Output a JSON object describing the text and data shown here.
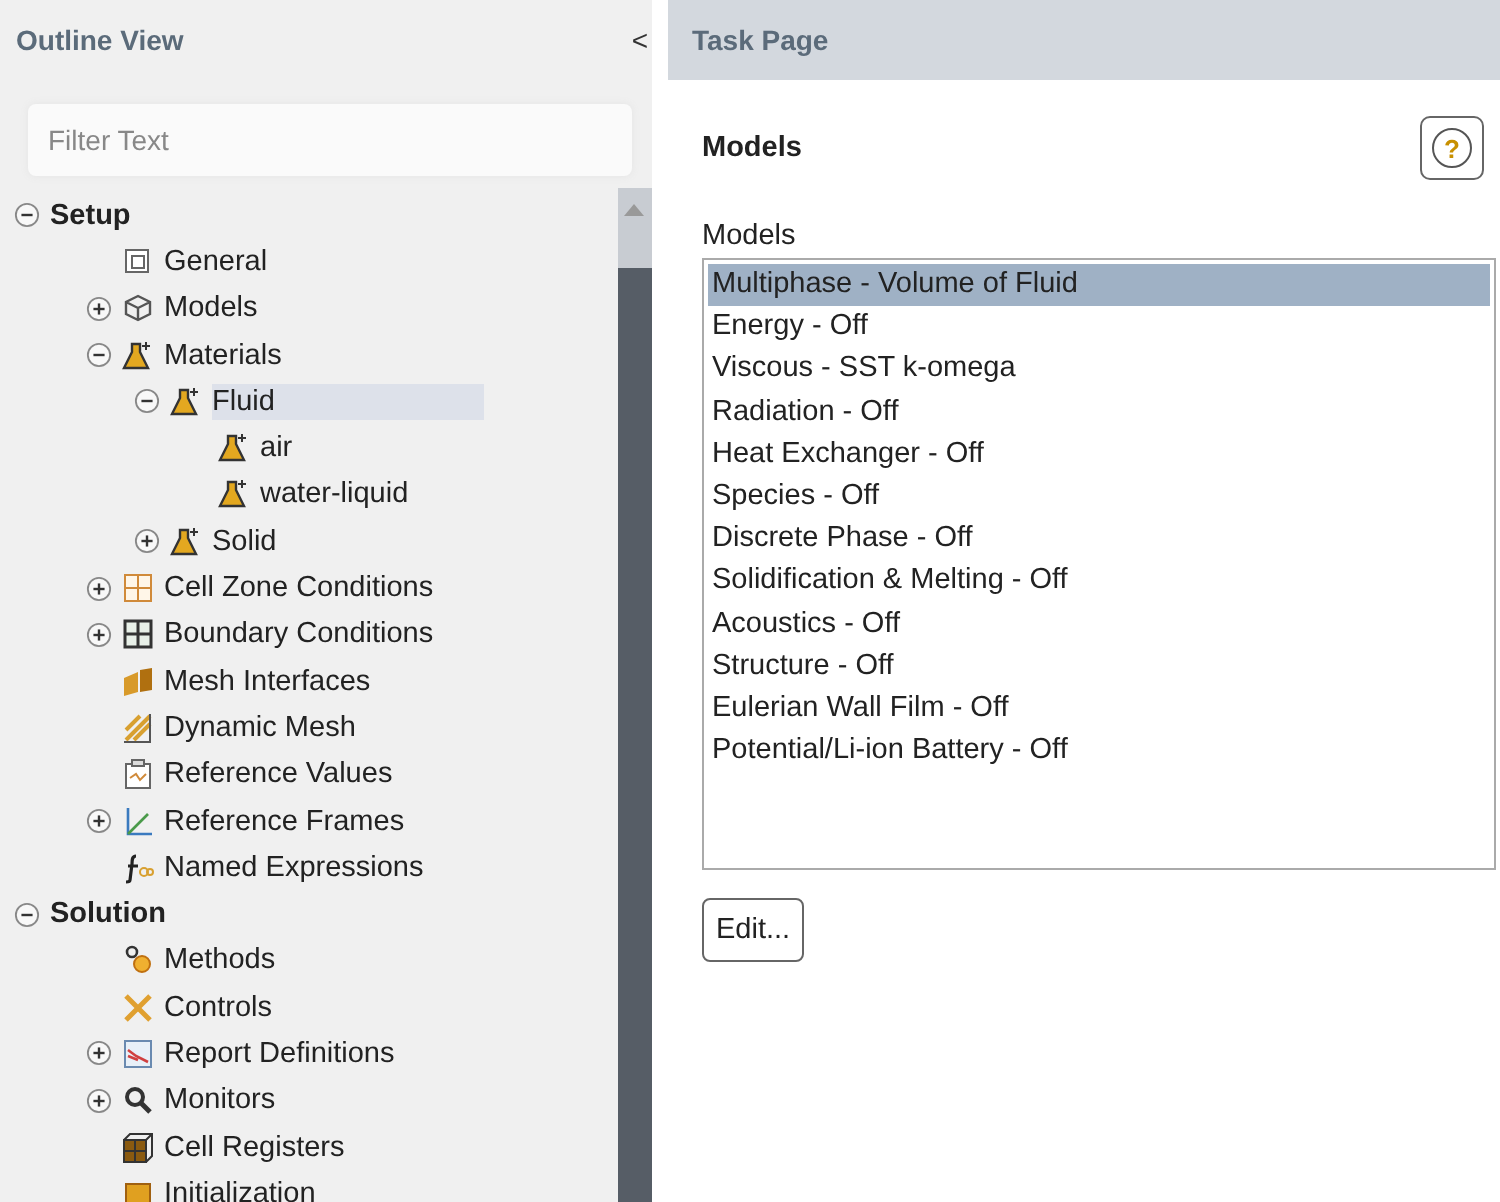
{
  "outline": {
    "title": "Outline View",
    "collapse": "<",
    "filter": {
      "placeholder": "Filter Text"
    },
    "tree": [
      {
        "label": "Setup",
        "kind": "section",
        "expanded": true,
        "selected": false,
        "children": [
          {
            "label": "General",
            "kind": "general",
            "selected": false
          },
          {
            "label": "Models",
            "kind": "models",
            "expanded": false,
            "selected": false
          },
          {
            "label": "Materials",
            "kind": "material",
            "expanded": true,
            "selected": false,
            "children": [
              {
                "label": "Fluid",
                "kind": "material",
                "expanded": true,
                "selected": true,
                "children": [
                  {
                    "label": "air",
                    "kind": "material",
                    "selected": false
                  },
                  {
                    "label": "water-liquid",
                    "kind": "material",
                    "selected": false
                  }
                ]
              },
              {
                "label": "Solid",
                "kind": "material",
                "expanded": false,
                "selected": false
              }
            ]
          },
          {
            "label": "Cell Zone Conditions",
            "kind": "grid",
            "expanded": false,
            "selected": false
          },
          {
            "label": "Boundary Conditions",
            "kind": "boundary",
            "expanded": false,
            "selected": false
          },
          {
            "label": "Mesh Interfaces",
            "kind": "interface",
            "selected": false
          },
          {
            "label": "Dynamic Mesh",
            "kind": "dynamic",
            "selected": false
          },
          {
            "label": "Reference Values",
            "kind": "clipboard",
            "selected": false
          },
          {
            "label": "Reference Frames",
            "kind": "axes",
            "expanded": false,
            "selected": false
          },
          {
            "label": "Named Expressions",
            "kind": "fx",
            "selected": false
          }
        ]
      },
      {
        "label": "Solution",
        "kind": "section",
        "expanded": true,
        "selected": false,
        "children": [
          {
            "label": "Methods",
            "kind": "methods",
            "selected": false
          },
          {
            "label": "Controls",
            "kind": "controls",
            "selected": false
          },
          {
            "label": "Report Definitions",
            "kind": "report",
            "expanded": false,
            "selected": false
          },
          {
            "label": "Monitors",
            "kind": "search",
            "expanded": false,
            "selected": false
          },
          {
            "label": "Cell Registers",
            "kind": "registers",
            "selected": false
          },
          {
            "label": "Initialization",
            "kind": "init",
            "selected": false
          }
        ]
      }
    ]
  },
  "task": {
    "title": "Task Page",
    "heading": "Models",
    "help": "?",
    "list_label": "Models",
    "models": [
      {
        "label": "Multiphase - Volume of Fluid",
        "selected": true
      },
      {
        "label": "Energy - Off",
        "selected": false
      },
      {
        "label": "Viscous - SST k-omega",
        "selected": false
      },
      {
        "label": "Radiation - Off",
        "selected": false
      },
      {
        "label": "Heat Exchanger - Off",
        "selected": false
      },
      {
        "label": "Species - Off",
        "selected": false
      },
      {
        "label": "Discrete Phase - Off",
        "selected": false
      },
      {
        "label": "Solidification & Melting - Off",
        "selected": false
      },
      {
        "label": "Acoustics - Off",
        "selected": false
      },
      {
        "label": "Structure - Off",
        "selected": false
      },
      {
        "label": "Eulerian Wall Film - Off",
        "selected": false
      },
      {
        "label": "Potential/Li-ion Battery - Off",
        "selected": false
      }
    ],
    "edit_button": "Edit..."
  }
}
